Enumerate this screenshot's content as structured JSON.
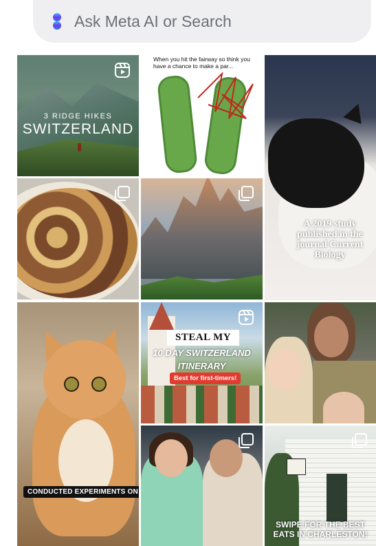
{
  "search": {
    "placeholder": "Ask Meta AI or Search",
    "icon": "meta-ai-icon",
    "accent_colors": [
      "#3fb6ff",
      "#6a3df0",
      "#2a7de1"
    ]
  },
  "grid": {
    "tiles": [
      {
        "name": "switzerland-hikes-reel",
        "type": "reel",
        "subtitle": "3 RIDGE HIKES",
        "title": "SWITZERLAND",
        "icon": "reels-icon"
      },
      {
        "name": "golf-fairway-post",
        "type": "post",
        "caption": "When you hit the fairway so think you have a chance to make a par..."
      },
      {
        "name": "cat-study-post",
        "type": "post",
        "caption": "A 2019 study published in the journal Current Biology"
      },
      {
        "name": "pasta-dish-post",
        "type": "carousel",
        "icon": "multiple-photos-icon"
      },
      {
        "name": "dolomites-post",
        "type": "carousel",
        "icon": "multiple-photos-icon"
      },
      {
        "name": "orange-cat-post",
        "type": "post",
        "caption": "CONDUCTED EXPERIMENTS ON"
      },
      {
        "name": "switzerland-itinerary-reel",
        "type": "reel",
        "line1": "STEAL MY",
        "line2": "10 DAY SWITZERLAND ITINERARY",
        "badge": "Best for first-timers!",
        "icon": "reels-icon"
      },
      {
        "name": "tennis-crowd-post",
        "type": "post"
      },
      {
        "name": "wimbledon-couple-post",
        "type": "carousel",
        "icon": "multiple-photos-icon"
      },
      {
        "name": "charleston-eats-post",
        "type": "carousel",
        "caption": "SWIPE FOR THE BEST EATS IN CHARLESTON!",
        "icon": "multiple-photos-icon"
      }
    ]
  }
}
